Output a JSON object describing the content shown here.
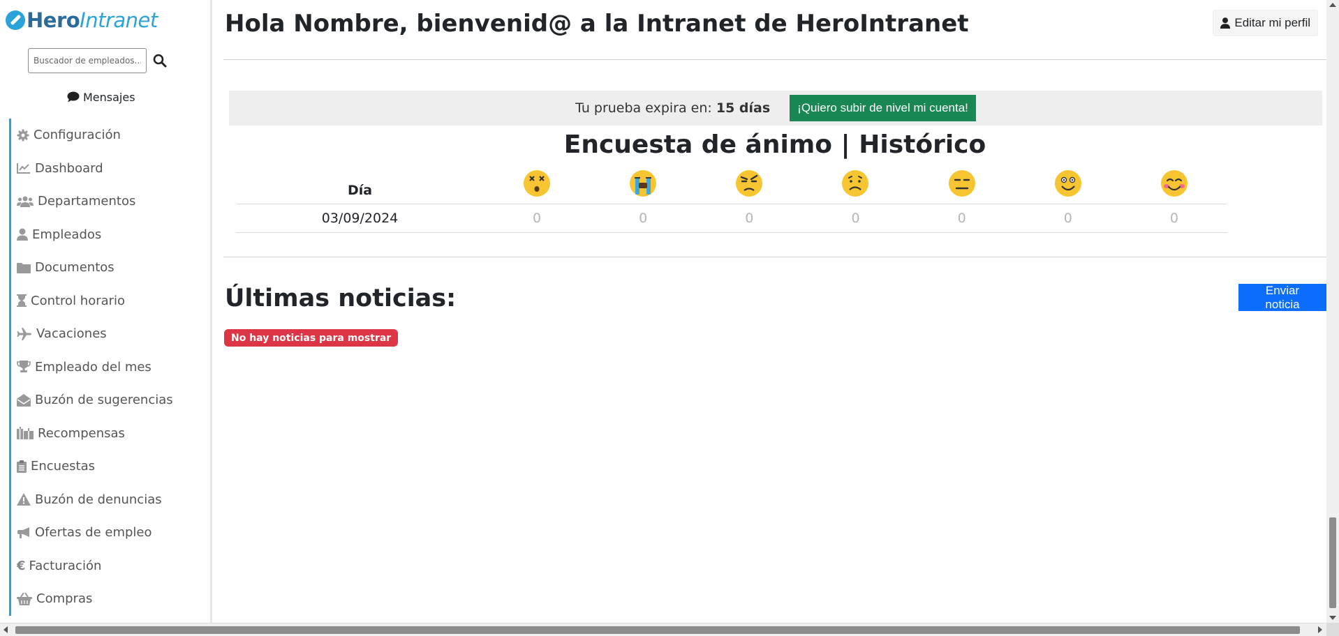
{
  "brand": {
    "hero": "Hero",
    "intranet": "Intranet",
    "accent": "#2aa3d8"
  },
  "sidebar": {
    "search_placeholder": "Buscador de empleados...",
    "messages_label": "Mensajes",
    "items": [
      {
        "label": "Configuración",
        "icon": "gear-icon"
      },
      {
        "label": "Dashboard",
        "icon": "chart-line-icon"
      },
      {
        "label": "Departamentos",
        "icon": "users-icon"
      },
      {
        "label": "Empleados",
        "icon": "user-icon"
      },
      {
        "label": "Documentos",
        "icon": "folder-icon"
      },
      {
        "label": "Control horario",
        "icon": "hourglass-icon"
      },
      {
        "label": "Vacaciones",
        "icon": "plane-icon"
      },
      {
        "label": "Empleado del mes",
        "icon": "trophy-icon"
      },
      {
        "label": "Buzón de sugerencias",
        "icon": "envelope-open-icon"
      },
      {
        "label": "Recompensas",
        "icon": "gifts-icon"
      },
      {
        "label": "Encuestas",
        "icon": "clipboard-icon"
      },
      {
        "label": "Buzón de denuncias",
        "icon": "warning-icon"
      },
      {
        "label": "Ofertas de empleo",
        "icon": "megaphone-icon"
      },
      {
        "label": "Facturación",
        "icon": "euro-icon"
      },
      {
        "label": "Compras",
        "icon": "basket-icon"
      }
    ]
  },
  "header": {
    "greeting_prefix": "Hola ",
    "user_name": "Nombre",
    "greeting_middle": ", bienvenid@ a la Intranet de ",
    "company": "HeroIntranet",
    "edit_profile": "Editar mi perfil"
  },
  "trial": {
    "label": "Tu prueba expira en:",
    "days": "15 días",
    "upgrade_button": "¡Quiero subir de nivel mi cuenta!",
    "upgrade_color": "#198754"
  },
  "survey": {
    "title": "Encuesta de ánimo | Histórico",
    "day_header": "Día",
    "moods": [
      "dizzy-face-icon",
      "crying-face-icon",
      "angry-face-icon",
      "sad-face-icon",
      "neutral-face-icon",
      "smiling-face-icon",
      "blushing-face-icon"
    ],
    "rows": [
      {
        "date": "03/09/2024",
        "values": [
          "0",
          "0",
          "0",
          "0",
          "0",
          "0",
          "0"
        ]
      }
    ]
  },
  "news": {
    "title": "Últimas noticias:",
    "send_button": "Enviar noticia",
    "empty_badge": "No hay noticias para mostrar",
    "send_color": "#0d6efd",
    "badge_color": "#dc3545"
  }
}
